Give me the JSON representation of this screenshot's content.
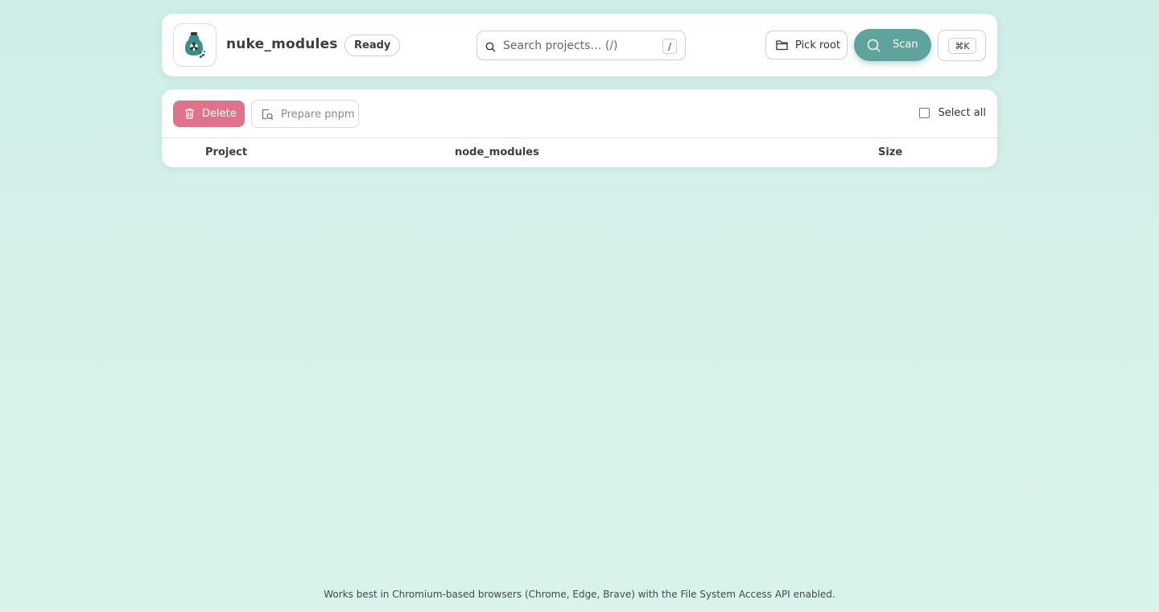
{
  "header": {
    "app_title": "nuke_modules",
    "status": "Ready",
    "search": {
      "placeholder": "Search projects… (/)",
      "shortcut": "/"
    },
    "pick_root_label": "Pick root",
    "scan_label": "Scan",
    "command_shortcut": "⌘K"
  },
  "toolbar": {
    "delete_label": "Delete",
    "prepare_pnpm_label": "Prepare pnpm",
    "select_all_label": "Select all"
  },
  "table": {
    "columns": [
      "Project",
      "node_modules",
      "Size"
    ],
    "rows": []
  },
  "footer": {
    "note": "Works best in Chromium-based browsers (Chrome, Edge, Brave) with the File System Access API enabled."
  },
  "colors": {
    "accent": "#5fa49c",
    "danger": "#e0728a",
    "background": "#d6f0ea"
  }
}
